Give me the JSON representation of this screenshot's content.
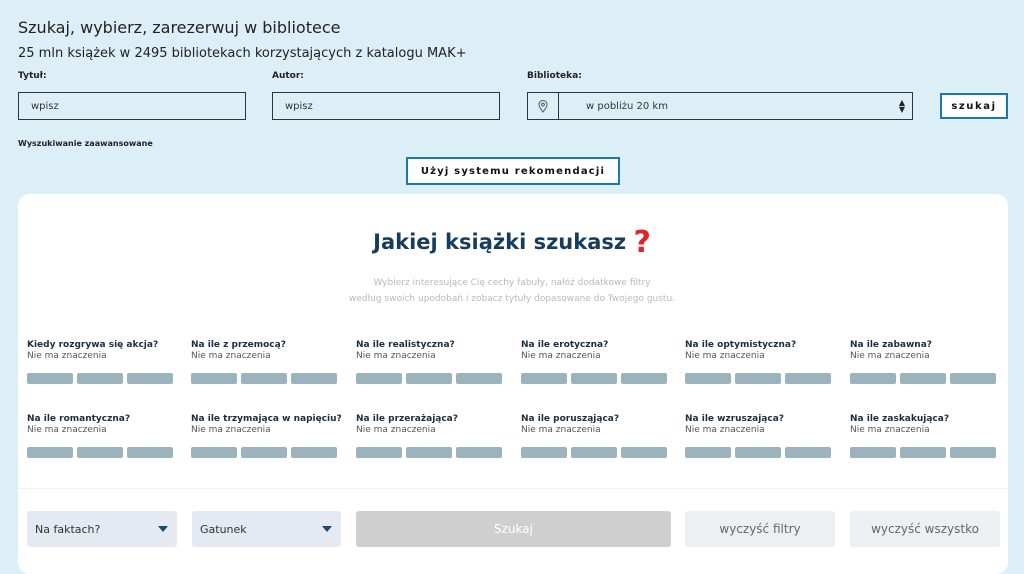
{
  "header": {
    "title": "Szukaj, wybierz, zarezerwuj w bibliotece",
    "subtitle": "25 mln książek w 2495 bibliotekach korzystających z katalogu MAK+"
  },
  "search": {
    "title_label": "Tytuł:",
    "title_placeholder": "wpisz",
    "author_label": "Autor:",
    "author_placeholder": "wpisz",
    "library_label": "Biblioteka:",
    "library_value": "w pobliżu 20 km",
    "search_button": "szukaj",
    "advanced_link": "Wyszukiwanie zaawansowane",
    "recommend_button": "Użyj systemu rekomendacji"
  },
  "recommend": {
    "headline": "Jakiej książki szukasz",
    "headline_mark": "?",
    "intro_line1": "Wybierz interesujące Cię cechy fabuły, nałóż dodatkowe filtry",
    "intro_line2": "według swoich upodobań i zobacz tytuły dopasowane do Twojego gustu.",
    "questions": [
      {
        "title": "Kiedy rozgrywa się akcja?",
        "value": "Nie ma znaczenia"
      },
      {
        "title": "Na ile z przemocą?",
        "value": "Nie ma znaczenia"
      },
      {
        "title": "Na ile realistyczna?",
        "value": "Nie ma znaczenia"
      },
      {
        "title": "Na ile erotyczna?",
        "value": "Nie ma znaczenia"
      },
      {
        "title": "Na ile optymistyczna?",
        "value": "Nie ma znaczenia"
      },
      {
        "title": "Na ile zabawna?",
        "value": "Nie ma znaczenia"
      },
      {
        "title": "Na ile romantyczna?",
        "value": "Nie ma znaczenia"
      },
      {
        "title": "Na ile trzymająca w napięciu?",
        "value": "Nie ma znaczenia"
      },
      {
        "title": "Na ile przerażająca?",
        "value": "Nie ma znaczenia"
      },
      {
        "title": "Na ile porusząjąca?",
        "value": "Nie ma znaczenia"
      },
      {
        "title": "Na ile wzruszająca?",
        "value": "Nie ma znaczenia"
      },
      {
        "title": "Na ile zaskakująca?",
        "value": "Nie ma znaczenia"
      }
    ],
    "filters": {
      "facts_select": "Na faktach?",
      "genre_select": "Gatunek",
      "search_button": "Szukaj",
      "clear_filters": "wyczyść filtry",
      "clear_all": "wyczyść wszystko"
    }
  },
  "colors": {
    "page_bg": "#dceff7",
    "accent_border": "#1a7ab0",
    "headline": "#173d5c",
    "question_mark": "#e02525",
    "slider_segment": "#9bb3bd"
  },
  "icons": {
    "location": "map-pin-icon",
    "select_arrows": "up-down-arrows-icon",
    "dropdown": "caret-down-icon"
  }
}
